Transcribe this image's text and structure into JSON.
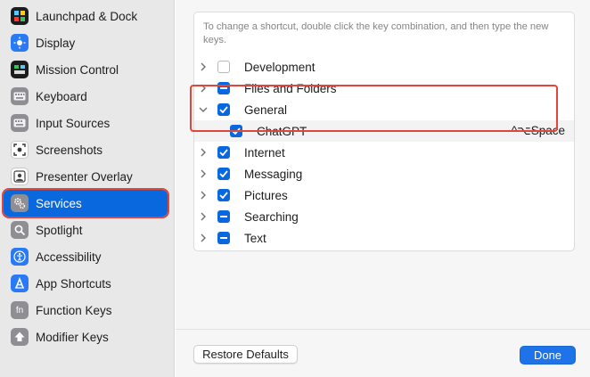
{
  "sidebar": {
    "items": [
      {
        "label": "Launchpad & Dock",
        "icon": "launchpad-dock-icon",
        "color": "#1c1c1e"
      },
      {
        "label": "Display",
        "icon": "display-icon",
        "color": "#2a7af5"
      },
      {
        "label": "Mission Control",
        "icon": "mission-control-icon",
        "color": "#1c1c1e"
      },
      {
        "label": "Keyboard",
        "icon": "keyboard-icon",
        "color": "#8e8e93"
      },
      {
        "label": "Input Sources",
        "icon": "input-sources-icon",
        "color": "#8e8e93"
      },
      {
        "label": "Screenshots",
        "icon": "screenshots-icon",
        "color": "#ffffff"
      },
      {
        "label": "Presenter Overlay",
        "icon": "presenter-overlay-icon",
        "color": "#ffffff"
      },
      {
        "label": "Services",
        "icon": "services-gear-icon",
        "color": "#8e8e93",
        "selected": true
      },
      {
        "label": "Spotlight",
        "icon": "spotlight-icon",
        "color": "#8e8e93"
      },
      {
        "label": "Accessibility",
        "icon": "accessibility-icon",
        "color": "#2a7af5"
      },
      {
        "label": "App Shortcuts",
        "icon": "app-shortcuts-icon",
        "color": "#2a7af5"
      },
      {
        "label": "Function Keys",
        "icon": "function-keys-icon",
        "color": "#8e8e93"
      },
      {
        "label": "Modifier Keys",
        "icon": "modifier-keys-icon",
        "color": "#8e8e93"
      }
    ]
  },
  "panel": {
    "hint": "To change a shortcut, double click the key combination, and then type the new keys.",
    "rows": [
      {
        "label": "Development",
        "state": "off",
        "expanded": false
      },
      {
        "label": "Files and Folders",
        "state": "mixed",
        "expanded": false
      },
      {
        "label": "General",
        "state": "on",
        "expanded": true
      },
      {
        "label": "ChatGPT",
        "state": "on",
        "child": true,
        "shortcut": "^⌥Space"
      },
      {
        "label": "Internet",
        "state": "on",
        "expanded": false
      },
      {
        "label": "Messaging",
        "state": "on",
        "expanded": false
      },
      {
        "label": "Pictures",
        "state": "on",
        "expanded": false
      },
      {
        "label": "Searching",
        "state": "mixed",
        "expanded": false
      },
      {
        "label": "Text",
        "state": "mixed",
        "expanded": false
      }
    ]
  },
  "footer": {
    "restore_label": "Restore Defaults",
    "done_label": "Done"
  },
  "colors": {
    "accent": "#0a68de",
    "highlight": "#e0463a"
  }
}
